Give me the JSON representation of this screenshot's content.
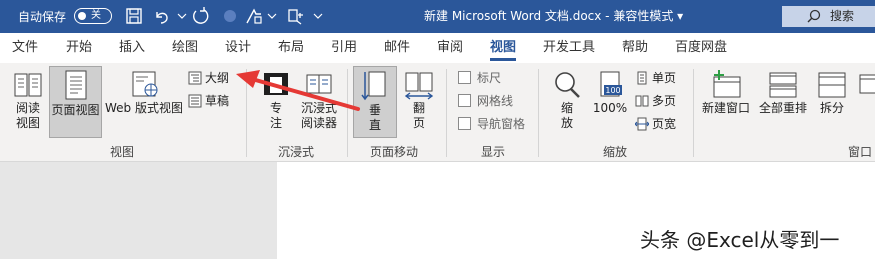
{
  "titlebar": {
    "autosave_label": "自动保存",
    "autosave_state": "关",
    "document_title": "新建 Microsoft Word 文档.docx  -  兼容性模式  ▾",
    "search_label": "搜索",
    "bg_color": "#2b579a"
  },
  "tabs": [
    "文件",
    "开始",
    "插入",
    "绘图",
    "设计",
    "布局",
    "引用",
    "邮件",
    "审阅",
    "视图",
    "开发工具",
    "帮助",
    "百度网盘"
  ],
  "active_tab": "视图",
  "ribbon": {
    "views": {
      "read_mode": "阅读\n视图",
      "print_layout": "页面视图",
      "web_layout": "Web 版式视图",
      "outline": "大纲",
      "draft": "草稿",
      "group_label": "视图"
    },
    "immersive": {
      "focus": "专\n注",
      "immersive_reader": "沉浸式\n阅读器",
      "group_label": "沉浸式"
    },
    "page_movement": {
      "vertical": "垂\n直",
      "side_to_side": "翻\n页",
      "group_label": "页面移动"
    },
    "show": {
      "ruler": "标尺",
      "gridlines": "网格线",
      "navigation_pane": "导航窗格",
      "group_label": "显示"
    },
    "zoom": {
      "zoom": "缩\n放",
      "hundred": "100%",
      "one_page": "单页",
      "multiple_pages": "多页",
      "page_width": "页宽",
      "group_label": "缩放",
      "hundred_icon_text": "100"
    },
    "window": {
      "new_window": "新建窗口",
      "arrange_all": "全部重排",
      "split": "拆分",
      "group_label": "窗口"
    }
  },
  "annotation": {
    "arrow_color": "#e53935"
  },
  "watermark": "头条 @Excel从零到一"
}
